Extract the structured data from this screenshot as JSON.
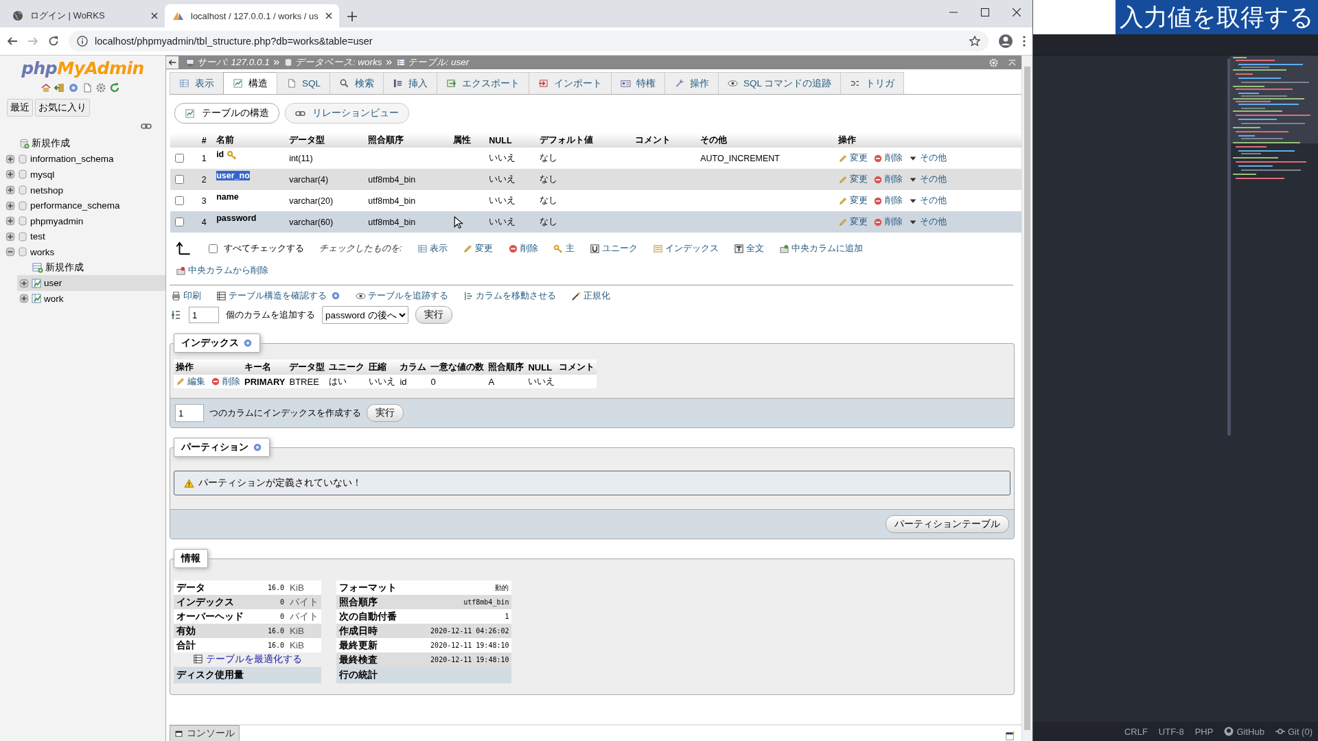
{
  "browser": {
    "tabs": [
      {
        "title": "ログイン | WoRKS",
        "selected": false
      },
      {
        "title": "localhost / 127.0.0.1 / works / us",
        "selected": true
      }
    ],
    "url": "localhost/phpmyadmin/tbl_structure.php?db=works&table=user"
  },
  "caption": "入力値を取得する",
  "sidebar": {
    "logo": [
      "php",
      "MyAdmin"
    ],
    "buttons": [
      "最近",
      "お気に入り"
    ],
    "tree": [
      {
        "label": "新規作成",
        "kind": "new",
        "selected": false
      },
      {
        "label": "information_schema",
        "kind": "database",
        "expanded": false,
        "selected": false
      },
      {
        "label": "mysql",
        "kind": "database",
        "expanded": false,
        "selected": false
      },
      {
        "label": "netshop",
        "kind": "database",
        "expanded": false,
        "selected": false
      },
      {
        "label": "performance_schema",
        "kind": "database",
        "expanded": false,
        "selected": false
      },
      {
        "label": "phpmyadmin",
        "kind": "database",
        "expanded": false,
        "selected": false
      },
      {
        "label": "test",
        "kind": "database",
        "expanded": false,
        "selected": false
      },
      {
        "label": "works",
        "kind": "database",
        "expanded": true,
        "selected": false,
        "children": [
          {
            "label": "新規作成",
            "kind": "new",
            "selected": false
          },
          {
            "label": "user",
            "kind": "table",
            "expanded": false,
            "selected": true
          },
          {
            "label": "work",
            "kind": "table",
            "expanded": false,
            "selected": false
          }
        ]
      }
    ]
  },
  "breadcrumb": [
    "サーバ: 127.0.0.1",
    "データベース: works",
    "テーブル: user"
  ],
  "tabs": [
    {
      "label": "表示",
      "selected": false
    },
    {
      "label": "構造",
      "selected": true
    },
    {
      "label": "SQL",
      "selected": false
    },
    {
      "label": "検索",
      "selected": false
    },
    {
      "label": "挿入",
      "selected": false
    },
    {
      "label": "エクスポート",
      "selected": false
    },
    {
      "label": "インポート",
      "selected": false
    },
    {
      "label": "特権",
      "selected": false
    },
    {
      "label": "操作",
      "selected": false
    },
    {
      "label": "SQL コマンドの追跡",
      "selected": false
    },
    {
      "label": "トリガ",
      "selected": false
    }
  ],
  "subtabs": [
    {
      "label": "テーブルの構造",
      "selected": true
    },
    {
      "label": "リレーションビュー",
      "selected": false
    }
  ],
  "structure": {
    "columns": [
      "#",
      "名前",
      "データ型",
      "照合順序",
      "属性",
      "NULL",
      "デフォルト値",
      "コメント",
      "その他",
      "操作"
    ],
    "rows": [
      {
        "num": "1",
        "name": "id",
        "primary": true,
        "text_selected": false,
        "type": "int(11)",
        "null": "いいえ",
        "default": "なし",
        "extra": "AUTO_INCREMENT",
        "checked": false,
        "hovered": false,
        "actions": [
          "変更",
          "削除",
          "その他"
        ]
      },
      {
        "num": "2",
        "name": "user_no",
        "primary": false,
        "text_selected": true,
        "type": "varchar(4)",
        "collation": "utf8mb4_bin",
        "null": "いいえ",
        "default": "なし",
        "checked": false,
        "hovered": false,
        "actions": [
          "変更",
          "削除",
          "その他"
        ]
      },
      {
        "num": "3",
        "name": "name",
        "primary": false,
        "text_selected": false,
        "type": "varchar(20)",
        "collation": "utf8mb4_bin",
        "null": "いいえ",
        "default": "なし",
        "checked": false,
        "hovered": false,
        "actions": [
          "変更",
          "削除",
          "その他"
        ]
      },
      {
        "num": "4",
        "name": "password",
        "primary": false,
        "text_selected": false,
        "type": "varchar(60)",
        "collation": "utf8mb4_bin",
        "null": "いいえ",
        "default": "なし",
        "checked": false,
        "hovered": true,
        "actions": [
          "変更",
          "削除",
          "その他"
        ]
      }
    ],
    "check_all": {
      "label": "すべてチェックする",
      "checked": false
    },
    "with_selected": "チェックしたものを:",
    "bulk_actions": [
      "表示",
      "変更",
      "削除",
      "主",
      "ユニーク",
      "インデックス",
      "全文",
      "中央カラムに追加",
      "中央カラムから削除"
    ]
  },
  "tools": [
    "印刷",
    "テーブル構造を確認する",
    "テーブルを追跡する",
    "カラムを移動させる",
    "正規化"
  ],
  "add_column": {
    "count": "1",
    "label": "個のカラムを追加する",
    "position": "password の後へ",
    "button": "実行"
  },
  "indexes": {
    "title": "インデックス",
    "action_column": "操作",
    "columns": [
      "キー名",
      "データ型",
      "ユニーク",
      "圧縮",
      "カラム",
      "一意な値の数",
      "照合順序",
      "NULL",
      "コメント"
    ],
    "rows": [
      {
        "actions": [
          "編集",
          "削除"
        ],
        "cells": [
          "PRIMARY",
          "BTREE",
          "はい",
          "いいえ",
          "id",
          "0",
          "A",
          "いいえ"
        ]
      }
    ],
    "create": {
      "count": "1",
      "label": "つのカラムにインデックスを作成する",
      "button": "実行"
    }
  },
  "partitions": {
    "title": "パーティション",
    "notice": "パーティションが定義されていない！",
    "button": "パーティションテーブル"
  },
  "info": {
    "title": "情報",
    "space": [
      {
        "label": "データ",
        "value": "16.0",
        "unit": "KiB"
      },
      {
        "label": "インデックス",
        "value": "0",
        "unit": "バイト"
      },
      {
        "label": "オーバーヘッド",
        "value": "0",
        "unit": "バイト"
      },
      {
        "label": "有効",
        "value": "16.0",
        "unit": "KiB"
      },
      {
        "label": "合計",
        "value": "16.0",
        "unit": "KiB"
      }
    ],
    "optimize": "テーブルを最適化する",
    "space_footer": "ディスク使用量",
    "stats": [
      {
        "label": "フォーマット",
        "value": "動的"
      },
      {
        "label": "照合順序",
        "value": "utf8mb4_bin"
      },
      {
        "label": "次の自動付番",
        "value": "1"
      },
      {
        "label": "作成日時",
        "value": "2020-12-11 04:26:02"
      },
      {
        "label": "最終更新",
        "value": "2020-12-11 19:48:10"
      },
      {
        "label": "最終検査",
        "value": "2020-12-11 19:48:10"
      }
    ],
    "stats_footer": "行の統計"
  },
  "console": "コンソール",
  "editor_status": [
    "CRLF",
    "UTF-8",
    "PHP",
    "GitHub",
    "Git (0)"
  ]
}
